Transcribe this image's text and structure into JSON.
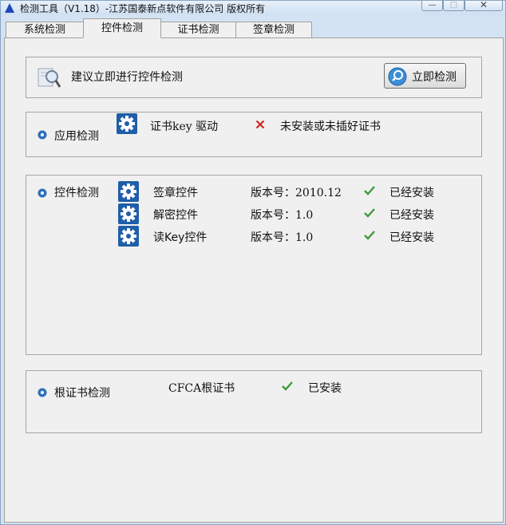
{
  "window": {
    "title": "检测工具（V1.18）-江苏国泰新点软件有限公司 版权所有",
    "controls": {
      "minimize": "—",
      "maximize": "□",
      "close": "✕"
    }
  },
  "tabs": [
    {
      "label": "系统检测",
      "active": false
    },
    {
      "label": "控件检测",
      "active": true
    },
    {
      "label": "证书检测",
      "active": false
    },
    {
      "label": "签章检测",
      "active": false
    }
  ],
  "advice": {
    "text": "建议立即进行控件检测",
    "icon": "magnifier-icon",
    "button_label": "立即检测",
    "button_icon": "search-icon"
  },
  "app_check": {
    "label": "应用检测",
    "items": [
      {
        "name": "证书key 驱动",
        "status_icon": "cross-icon",
        "status": "未安装或未插好证书"
      }
    ]
  },
  "control_check": {
    "label": "控件检测",
    "items": [
      {
        "name": "签章控件",
        "version": "版本号：2010.12",
        "status_icon": "check-icon",
        "status": "已经安装"
      },
      {
        "name": "解密控件",
        "version": "版本号：1.0",
        "status_icon": "check-icon",
        "status": "已经安装"
      },
      {
        "name": "读Key控件",
        "version": "版本号：1.0",
        "status_icon": "check-icon",
        "status": "已经安装"
      }
    ]
  },
  "root_cert_check": {
    "label": "根证书检测",
    "items": [
      {
        "name": "CFCA根证书",
        "status_icon": "check-icon",
        "status": "已安装"
      }
    ]
  },
  "colors": {
    "title_icon": "#1f49b6",
    "error": "#d41c1c",
    "success": "#3f9a3a",
    "gear": "#2a6ab1",
    "bullet": "#2b6fb8"
  }
}
